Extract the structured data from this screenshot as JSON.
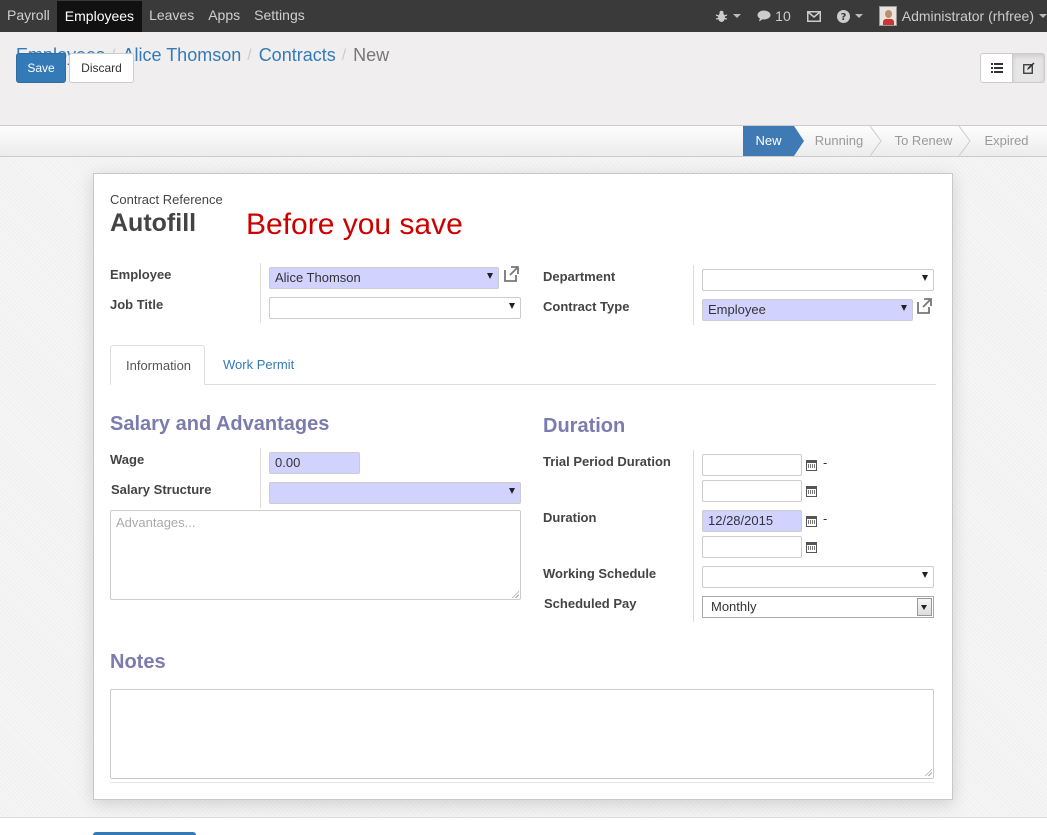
{
  "topnav": {
    "menu": [
      {
        "label": "Payroll",
        "active": false
      },
      {
        "label": "Employees",
        "active": true
      },
      {
        "label": "Leaves",
        "active": false
      },
      {
        "label": "Apps",
        "active": false
      },
      {
        "label": "Settings",
        "active": false
      }
    ],
    "messages_count": "10",
    "user_label": "Administrator (rhfree)"
  },
  "breadcrumb": {
    "items": [
      "Employees",
      "Alice Thomson",
      "Contracts"
    ],
    "current": "New"
  },
  "toolbar": {
    "save_label": "Save",
    "discard_label": "Discard"
  },
  "statusbar": {
    "stages": [
      "New",
      "Running",
      "To Renew",
      "Expired"
    ],
    "active": "New"
  },
  "form": {
    "ref_label": "Contract Reference",
    "ref_value": "Autofill",
    "annotation": "Before you save",
    "employee_label": "Employee",
    "employee_value": "Alice Thomson",
    "job_title_label": "Job Title",
    "job_title_value": "",
    "department_label": "Department",
    "department_value": "",
    "contract_type_label": "Contract Type",
    "contract_type_value": "Employee"
  },
  "tabs": [
    {
      "label": "Information"
    },
    {
      "label": "Work Permit"
    }
  ],
  "salary": {
    "heading": "Salary and Advantages",
    "wage_label": "Wage",
    "wage_value": "0.00",
    "structure_label": "Salary Structure",
    "structure_value": "",
    "advantages_placeholder": "Advantages..."
  },
  "duration": {
    "heading": "Duration",
    "trial_label": "Trial Period Duration",
    "duration_label": "Duration",
    "duration_start": "12/28/2015",
    "working_schedule_label": "Working Schedule",
    "working_schedule_value": "",
    "scheduled_pay_label": "Scheduled Pay",
    "scheduled_pay_value": "Monthly"
  },
  "notes": {
    "heading": "Notes"
  },
  "colors": {
    "accent": "#337ab7",
    "required_bg": "#d2d2ff",
    "section_heading": "#7c7bad",
    "annotation": "#cc0000",
    "status_active": "#3f7ab5"
  }
}
